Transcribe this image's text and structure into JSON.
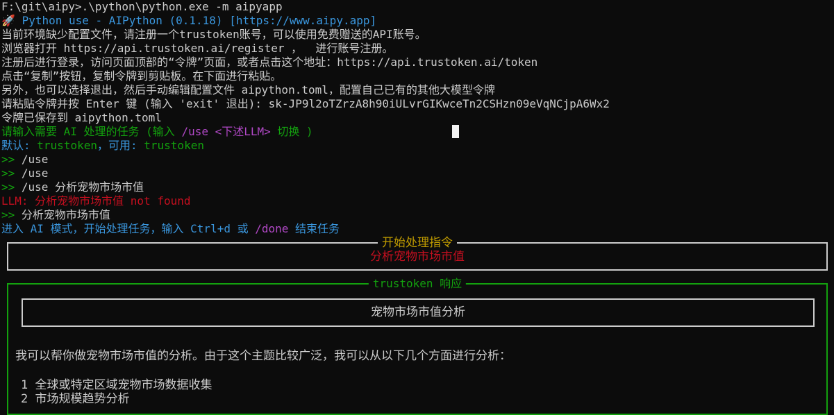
{
  "terminal": {
    "command_line": "F:\\git\\aipy>.\\python\\python.exe -m aipyapp",
    "banner": {
      "icon": "rocket-icon",
      "text": "Python use - AIPython (0.1.18)",
      "url": "[https://www.aipy.app]"
    },
    "setup_lines": [
      "当前环境缺少配置文件，请注册一个trustoken账号，可以使用免费赠送的API账号。",
      "浏览器打开 https://api.trustoken.ai/register ，  进行账号注册。",
      "注册后进行登录，访问页面顶部的“令牌”页面，或者点击这个地址：https://api.trustoken.ai/token",
      "点击“复制”按钮，复制令牌到剪贴板。在下面进行粘贴。",
      "另外，也可以选择退出，然后手动编辑配置文件 aipython.toml，配置自己已有的其他大模型令牌",
      "请粘贴令牌并按 Enter 键 (输入 'exit' 退出): sk-JP9l2oTZrzA8h90iULvrGIKwceTn2CSHzn09eVqNCjpA6Wx2",
      "令牌已保存到 aipython.toml"
    ],
    "task_prompt": {
      "part1": "请输入需要 AI 处理的任务 (输入 ",
      "cmd": "/use",
      "part2": " ",
      "angle": "<下述LLM>",
      "part3": " 切换 )"
    },
    "default_line": {
      "label1": "默认: ",
      "val1": "trustoken",
      "label2": "，可用: ",
      "val2": "trustoken"
    },
    "prompt_symbol": ">>",
    "inputs": [
      " /use",
      " /use",
      " /use 分析宠物市场市值"
    ],
    "error_line": "LLM: 分析宠物市场市值 not found",
    "input4": " 分析宠物市场市值",
    "ai_mode": {
      "part1": "进入 AI 模式，开始处理任务，输入 Ctrl+d 或 ",
      "cmd": "/done",
      "part2": " 结束任务"
    }
  },
  "start_panel": {
    "title": "开始处理指令",
    "body": "分析宠物市场市值"
  },
  "response_panel": {
    "title": "trustoken 响应",
    "heading": "宠物市场市值分析",
    "intro": "我可以帮你做宠物市场市值的分析。由于这个主题比较广泛，我可以从以下几个方面进行分析：",
    "items": [
      {
        "num": "1",
        "text": "全球或特定区域宠物市场数据收集"
      },
      {
        "num": "2",
        "text": "市场规模趋势分析"
      }
    ]
  }
}
